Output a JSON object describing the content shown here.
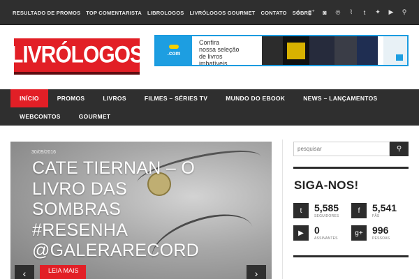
{
  "topbar": {
    "nav": [
      "RESULTADO DE PROMOS",
      "TOP COMENTARISTA",
      "LIBROLOGOS",
      "LIVRÓLOGOS GOURMET",
      "CONTATO",
      "SOBRE"
    ],
    "social_icons": [
      "facebook-icon",
      "google-plus-icon",
      "instagram-icon",
      "pinterest-icon",
      "rss-icon",
      "tumblr-icon",
      "twitter-icon",
      "youtube-icon",
      "search-icon"
    ]
  },
  "header": {
    "logo_text": "LIVRÓLOGOS",
    "ad": {
      "brand": ".com",
      "line1": "Confira",
      "line2": "nossa seleção",
      "line3": "de livros",
      "line4": "imbatíveis"
    }
  },
  "nav": {
    "row1": [
      "INÍCIO",
      "PROMOS",
      "LIVROS",
      "FILMES – SÉRIES TV",
      "MUNDO DO EBOOK",
      "NEWS – LANÇAMENTOS"
    ],
    "row2": [
      "WEBCONTOS",
      "GOURMET"
    ],
    "active": "INÍCIO"
  },
  "slider": {
    "date": "30/09/2016",
    "title": "CATE TIERNAN – O LIVRO DAS SOMBRAS #RESENHA @GALERARECORD",
    "read_more": "LEIA MAIS",
    "prev": "‹",
    "next": "›"
  },
  "sidebar": {
    "search_placeholder": "pesquisar",
    "follow_title": "SIGA-NOS!",
    "stats": [
      {
        "icon": "twitter-icon",
        "glyph": "t",
        "count": "5,585",
        "label": "SEGUIDORES"
      },
      {
        "icon": "facebook-icon",
        "glyph": "f",
        "count": "5,541",
        "label": "FÃS"
      },
      {
        "icon": "youtube-icon",
        "glyph": "▶",
        "count": "0",
        "label": "ASSINANTES"
      },
      {
        "icon": "google-plus-icon",
        "glyph": "g+",
        "count": "996",
        "label": "PESSOAS"
      }
    ]
  },
  "colors": {
    "accent": "#e21f26",
    "dark_bar": "#2f2f2f",
    "ad_blue": "#1d9ee1"
  }
}
